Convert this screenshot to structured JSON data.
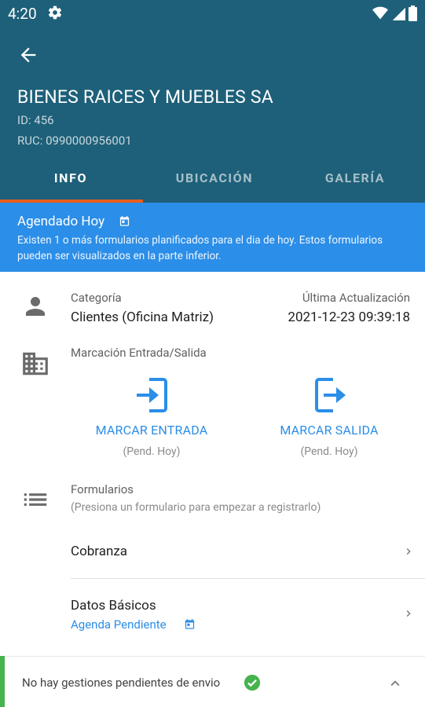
{
  "status_bar": {
    "time": "4:20"
  },
  "header": {
    "company_name": "BIENES RAICES Y MUEBLES SA",
    "id_text": "ID: 456",
    "ruc_text": "RUC: 0990000956001"
  },
  "tabs": [
    {
      "label": "INFO"
    },
    {
      "label": "UBICACIÓN"
    },
    {
      "label": "GALERÍA"
    }
  ],
  "banner": {
    "title": "Agendado Hoy",
    "text": "Existen 1 o más formularios planificados para el dia de hoy. Estos formularios pueden ser visualizados en la parte inferior."
  },
  "info": {
    "category_label": "Categoría",
    "category_value": "Clientes (Oficina Matriz)",
    "last_update_label": "Última Actualización",
    "last_update_value": "2021-12-23 09:39:18"
  },
  "attendance": {
    "label": "Marcación Entrada/Salida",
    "entry_label": "MARCAR ENTRADA",
    "entry_status": "(Pend. Hoy)",
    "exit_label": "MARCAR SALIDA",
    "exit_status": "(Pend. Hoy)"
  },
  "forms": {
    "title": "Formularios",
    "hint": "(Presiona un formulario para empezar a registrarlo)",
    "items": [
      {
        "label": "Cobranza"
      },
      {
        "label": "Datos Básicos",
        "sub": "Agenda Pendiente"
      }
    ]
  },
  "bottom_bar": {
    "text": "No hay gestiones pendientes de envio"
  },
  "colors": {
    "header": "#1e6079",
    "tab_indicator": "#e85e1c",
    "banner": "#2b8ee8",
    "accent_blue": "#2b8ee8",
    "success": "#46b34e"
  }
}
